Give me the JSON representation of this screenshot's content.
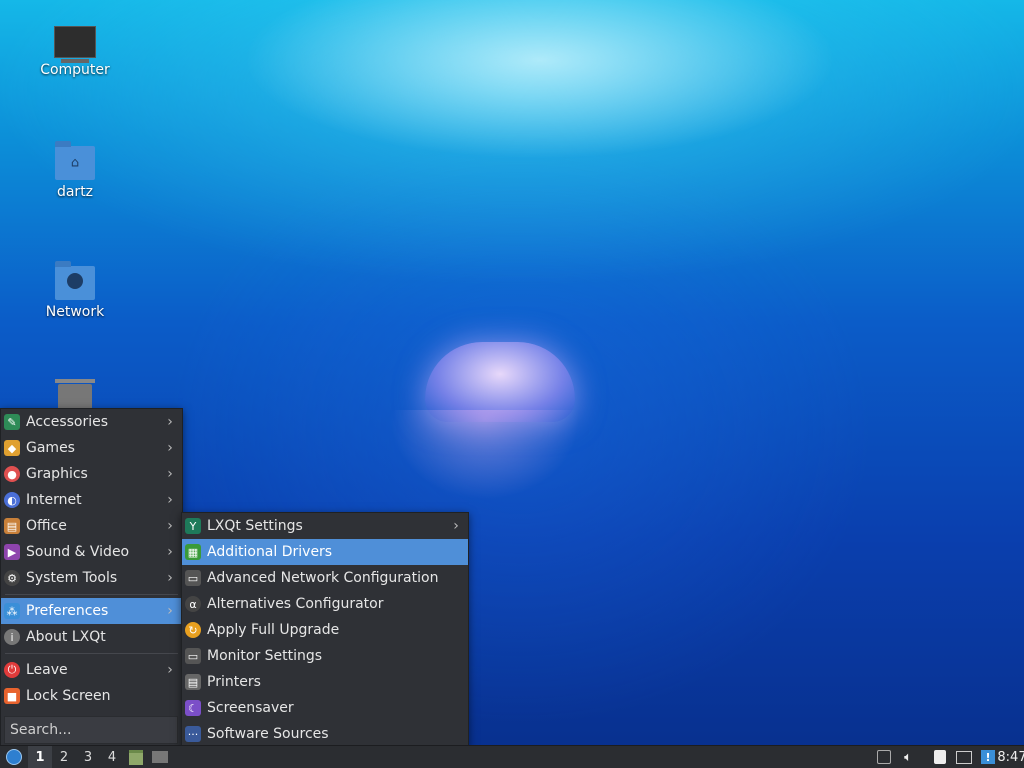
{
  "desktop": {
    "icons": [
      {
        "label": "Computer",
        "icon": "computer-icon"
      },
      {
        "label": "dartz",
        "icon": "home-folder-icon"
      },
      {
        "label": "Network",
        "icon": "network-folder-icon"
      },
      {
        "label": "",
        "icon": "trash-icon"
      }
    ]
  },
  "main_menu": {
    "items": [
      {
        "label": "Accessories",
        "icon": "accessories-icon",
        "color": "#2e8b57"
      },
      {
        "label": "Games",
        "icon": "games-icon",
        "color": "#e0a030"
      },
      {
        "label": "Graphics",
        "icon": "graphics-icon",
        "color": "#e05050"
      },
      {
        "label": "Internet",
        "icon": "internet-icon",
        "color": "#4b6fd6"
      },
      {
        "label": "Office",
        "icon": "office-icon",
        "color": "#c8803a"
      },
      {
        "label": "Sound & Video",
        "icon": "sound-video-icon",
        "color": "#8e44ad"
      },
      {
        "label": "System Tools",
        "icon": "system-tools-icon",
        "color": "#444"
      },
      {
        "label": "Preferences",
        "icon": "preferences-icon",
        "color": "#3a8fd8"
      },
      {
        "label": "About LXQt",
        "icon": "about-icon",
        "color": "#777"
      },
      {
        "label": "Leave",
        "icon": "leave-icon",
        "color": "#e03b3b"
      },
      {
        "label": "Lock Screen",
        "icon": "lock-icon",
        "color": "#e8632e"
      }
    ],
    "search_placeholder": "Search..."
  },
  "sub_menu": {
    "items": [
      {
        "label": "LXQt Settings",
        "icon": "lxqt-settings-icon"
      },
      {
        "label": "Additional Drivers",
        "icon": "drivers-icon"
      },
      {
        "label": "Advanced Network Configuration",
        "icon": "network-config-icon"
      },
      {
        "label": "Alternatives Configurator",
        "icon": "alternatives-icon"
      },
      {
        "label": "Apply Full Upgrade",
        "icon": "upgrade-icon"
      },
      {
        "label": "Monitor Settings",
        "icon": "monitor-icon"
      },
      {
        "label": "Printers",
        "icon": "printer-icon"
      },
      {
        "label": "Screensaver",
        "icon": "screensaver-icon"
      },
      {
        "label": "Software Sources",
        "icon": "software-sources-icon"
      }
    ]
  },
  "taskbar": {
    "workspaces": [
      "1",
      "2",
      "3",
      "4"
    ],
    "clock": "8:47"
  },
  "colors": {
    "menu_bg": "#2f3136",
    "highlight": "#4f8fd8"
  }
}
